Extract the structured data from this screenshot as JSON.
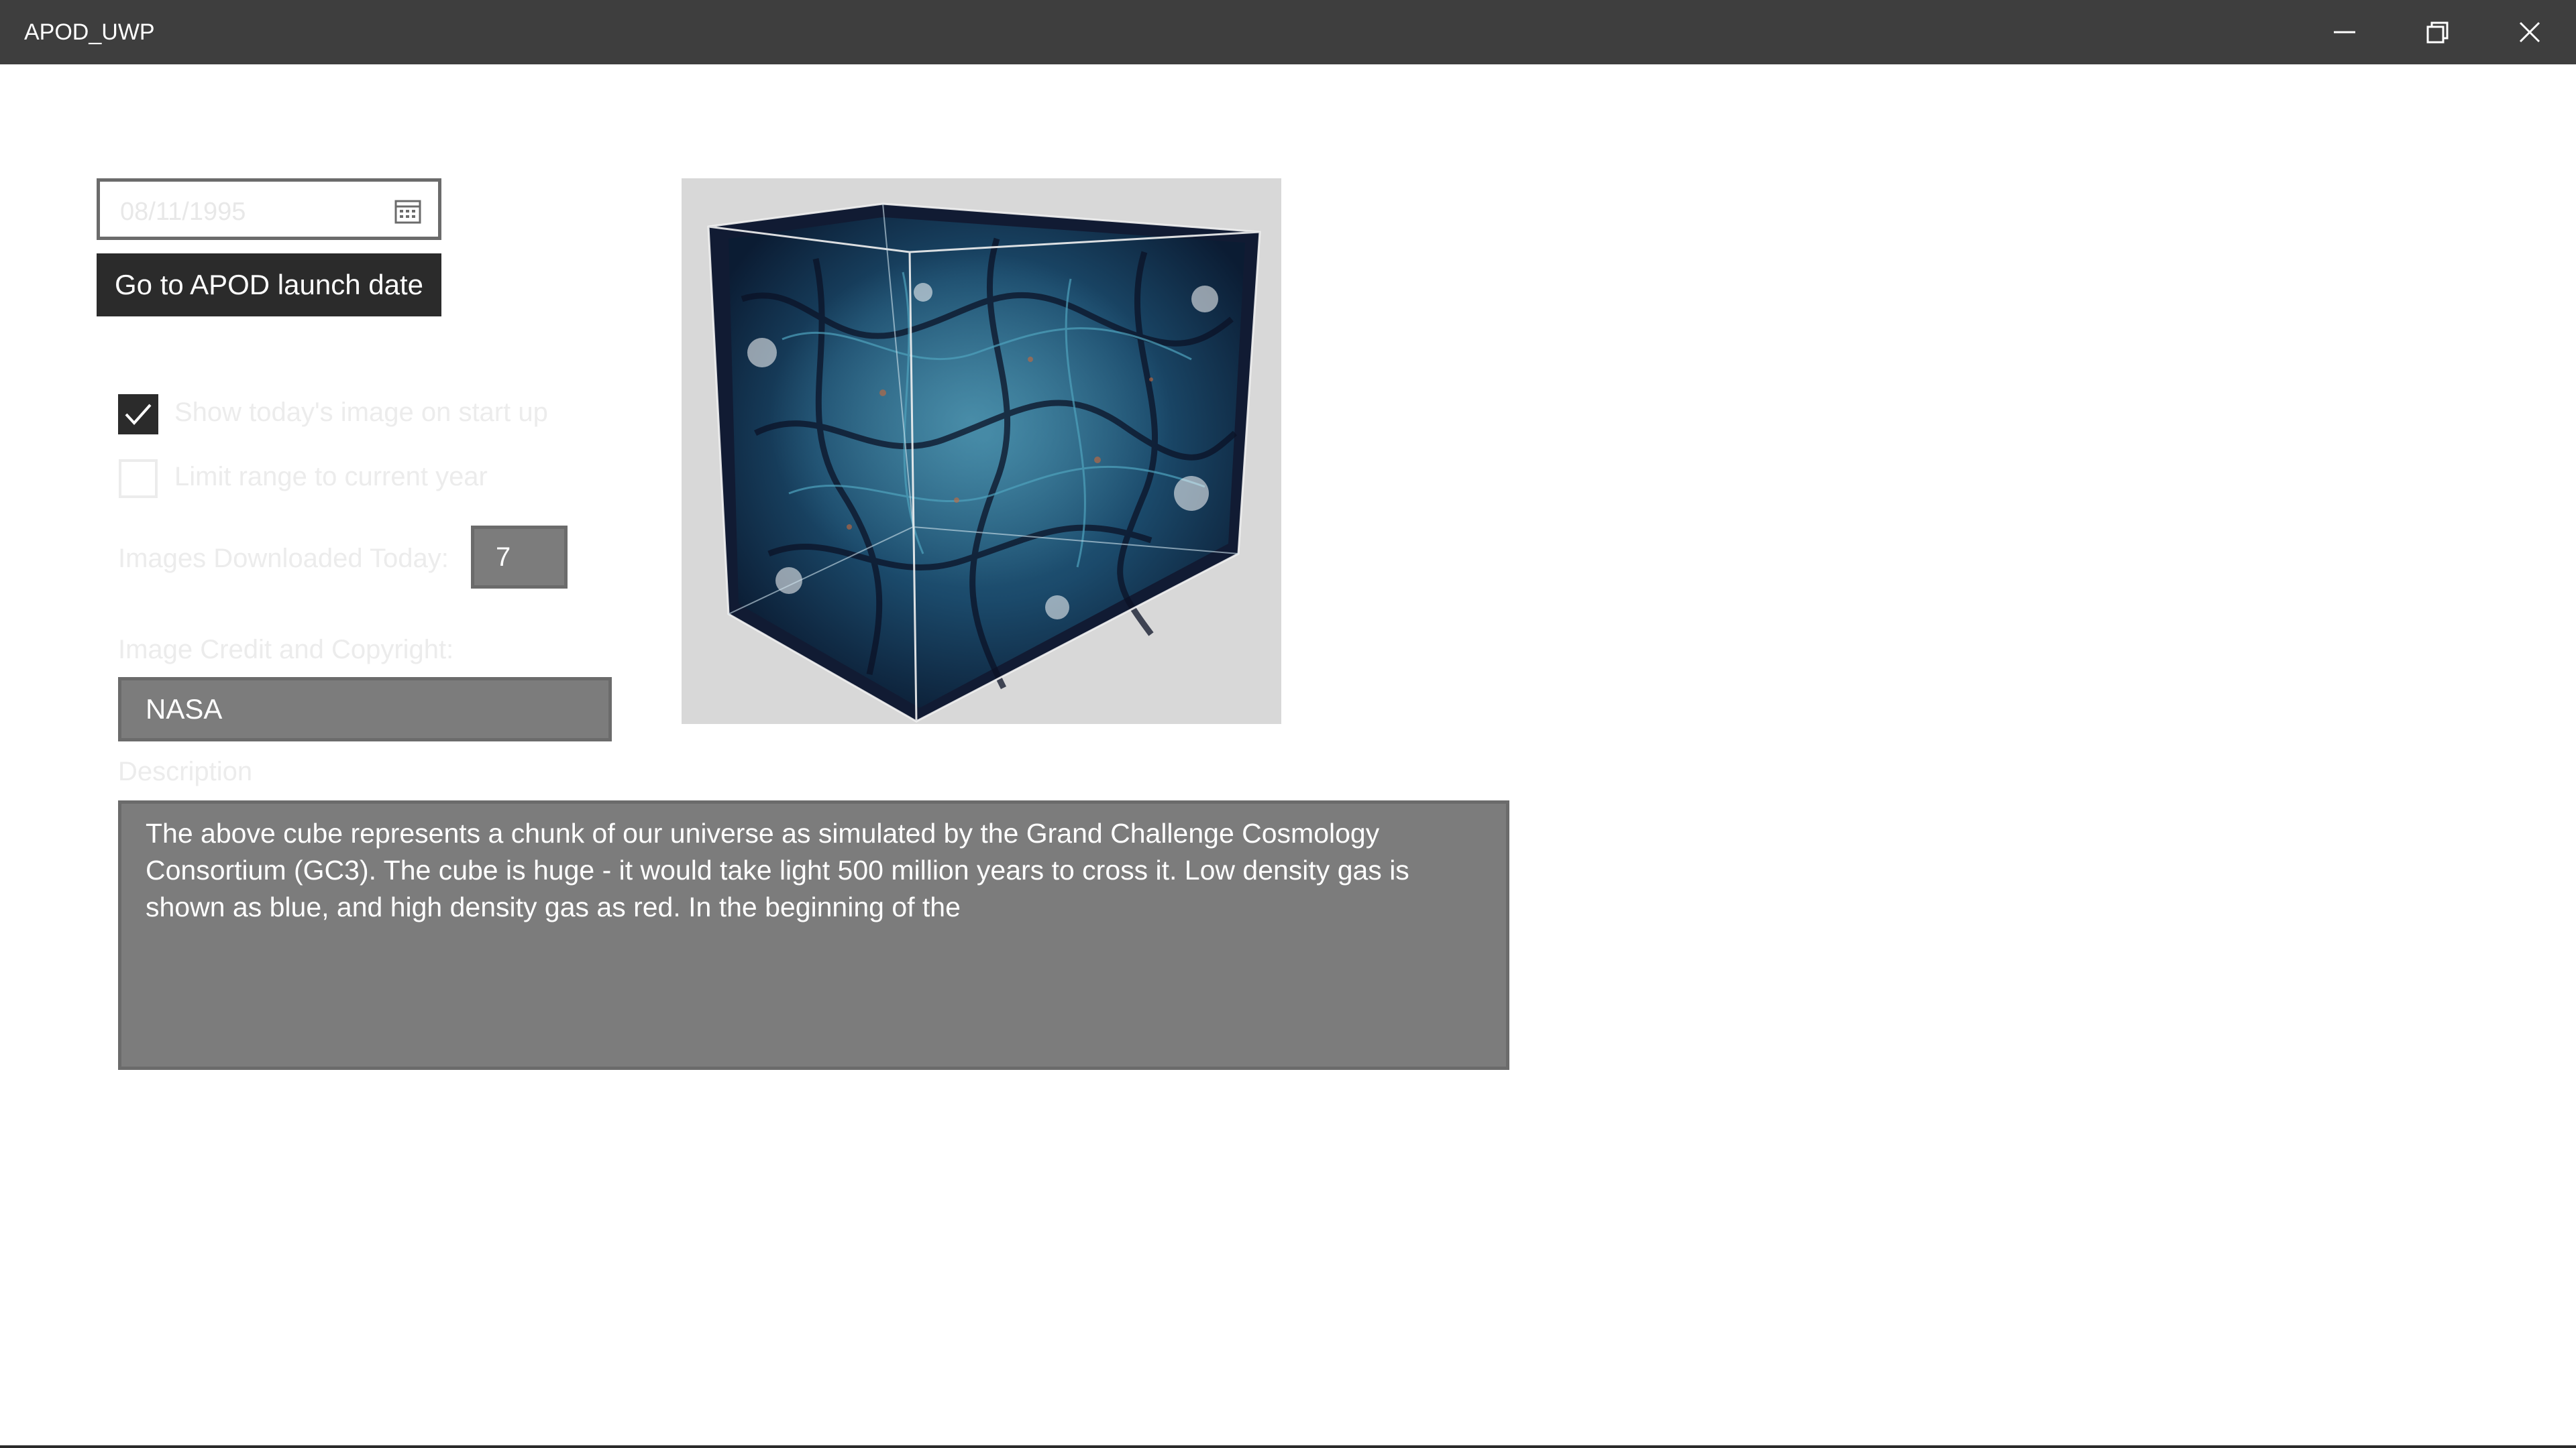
{
  "window": {
    "title": "APOD_UWP",
    "controls": {
      "minimize_icon": "minimize-icon",
      "maximize_icon": "restore-icon",
      "close_icon": "close-icon"
    }
  },
  "date_picker": {
    "value": "08/11/1995",
    "icon": "calendar-icon"
  },
  "launch_button": {
    "label": "Go to APOD launch date"
  },
  "options": {
    "show_today": {
      "label": "Show today's image on start up",
      "checked": true
    },
    "limit_range": {
      "label": "Limit range to current year",
      "checked": false
    }
  },
  "downloads": {
    "label": "Images Downloaded Today:",
    "value": "7"
  },
  "credit": {
    "label": "Image Credit and Copyright:",
    "value": "NASA"
  },
  "description": {
    "label": "Description",
    "value": "The above cube represents a chunk of our universe as simulated by the Grand Challenge Cosmology Consortium (GC3).  The cube is huge - it would take light 500 million years to cross it. Low density gas is shown as blue, and high density gas as red.  In the beginning of the"
  },
  "colors": {
    "titlebar": "#3e3e3e",
    "button": "#2b2b2b",
    "field": "#7c7c7c",
    "label_faded": "#ececec"
  }
}
